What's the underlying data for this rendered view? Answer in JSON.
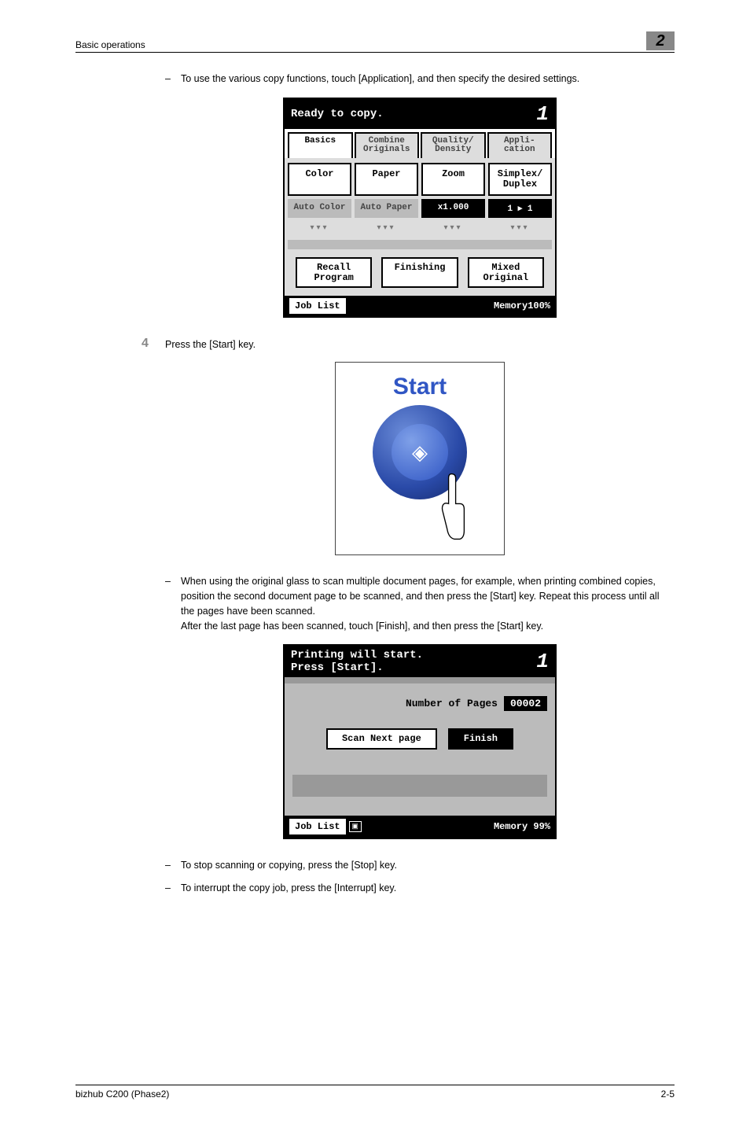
{
  "header": {
    "section": "Basic operations",
    "chapter": "2"
  },
  "intro_bullet": "To use the various copy functions, touch [Application], and then specify the desired settings.",
  "screen1": {
    "status": "Ready to copy.",
    "count": "1",
    "tabs": {
      "basics": "Basics",
      "combine": "Combine Originals",
      "quality": "Quality/ Density",
      "application": "Appli- cation"
    },
    "headers": {
      "color": "Color",
      "paper": "Paper",
      "zoom": "Zoom",
      "simplex": "Simplex/ Duplex"
    },
    "values": {
      "color": "Auto Color",
      "paper": "Auto Paper",
      "zoom": "x1.000",
      "duplex": "1 ▸ 1"
    },
    "buttons": {
      "recall": "Recall Program",
      "finishing": "Finishing",
      "mixed": "Mixed Original"
    },
    "job_list": "Job List",
    "memory": "Memory100%"
  },
  "step4": {
    "num": "4",
    "text": "Press the [Start] key.",
    "start_label": "Start"
  },
  "post_start": {
    "b1": "When using the original glass to scan multiple document pages, for example, when printing combined copies, position the second document page to be scanned, and then press the [Start] key. Repeat this process until all the pages have been scanned.",
    "b1_after": "After the last page has been scanned, touch [Finish], and then press the [Start] key."
  },
  "screen2": {
    "status1": "Printing will start.",
    "status2": "Press [Start].",
    "count": "1",
    "pages_label": "Number of Pages",
    "pages_value": "00002",
    "scan_next": "Scan Next page",
    "finish": "Finish",
    "job_list": "Job List",
    "memory": "Memory 99%"
  },
  "bottom_bullets": {
    "b1": "To stop scanning or copying, press the [Stop] key.",
    "b2": "To interrupt the copy job, press the [Interrupt] key."
  },
  "footer": {
    "left": "bizhub C200 (Phase2)",
    "right": "2-5"
  }
}
